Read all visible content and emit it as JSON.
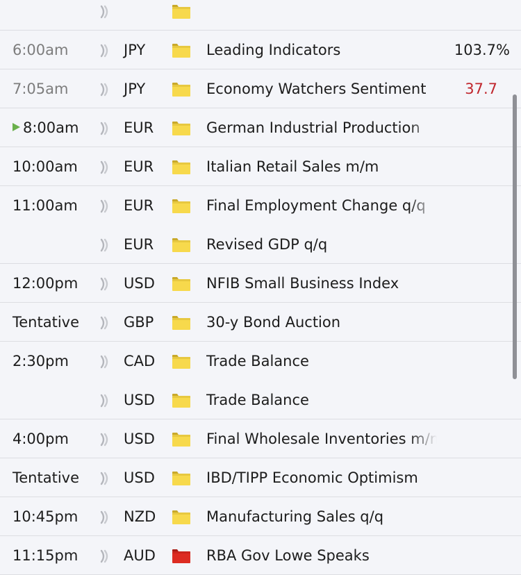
{
  "colors": {
    "background": "#f4f5f9",
    "separator": "#dcdde2",
    "impact_medium": "#f7d94c",
    "impact_high": "#dd2c22",
    "negative_value": "#c0262d",
    "now_marker": "#6ab04c"
  },
  "icons": {
    "sound": "speaker-waves-icon",
    "impact_medium": "yellow-folder-icon",
    "impact_high": "red-folder-icon",
    "now": "play-triangle-icon"
  },
  "events": [
    {
      "time": "",
      "currency": "",
      "impact": "medium",
      "title": "",
      "actual": "",
      "separator": true
    },
    {
      "time": "6:00am",
      "currency": "JPY",
      "impact": "medium",
      "title": "Leading Indicators",
      "actual": "103.7%",
      "past": true,
      "separator": true
    },
    {
      "time": "7:05am",
      "currency": "JPY",
      "impact": "medium",
      "title": "Economy Watchers Sentiment",
      "actual": "37.7",
      "actual_red": true,
      "past": true,
      "separator": true
    },
    {
      "time": "8:00am",
      "currency": "EUR",
      "impact": "medium",
      "title": "German Industrial Production",
      "actual": "",
      "now": true,
      "separator": true
    },
    {
      "time": "10:00am",
      "currency": "EUR",
      "impact": "medium",
      "title": "Italian Retail Sales m/m",
      "actual": "",
      "separator": true
    },
    {
      "time": "11:00am",
      "currency": "EUR",
      "impact": "medium",
      "title": "Final Employment Change q/q",
      "actual": "",
      "separator": false
    },
    {
      "time": "",
      "currency": "EUR",
      "impact": "medium",
      "title": "Revised GDP q/q",
      "actual": "",
      "separator": true
    },
    {
      "time": "12:00pm",
      "currency": "USD",
      "impact": "medium",
      "title": "NFIB Small Business Index",
      "actual": "",
      "separator": true
    },
    {
      "time": "Tentative",
      "currency": "GBP",
      "impact": "medium",
      "title": "30-y Bond Auction",
      "actual": "",
      "separator": true
    },
    {
      "time": "2:30pm",
      "currency": "CAD",
      "impact": "medium",
      "title": "Trade Balance",
      "actual": "",
      "separator": false
    },
    {
      "time": "",
      "currency": "USD",
      "impact": "medium",
      "title": "Trade Balance",
      "actual": "",
      "separator": true
    },
    {
      "time": "4:00pm",
      "currency": "USD",
      "impact": "medium",
      "title": "Final Wholesale Inventories m/m",
      "actual": "",
      "separator": true
    },
    {
      "time": "Tentative",
      "currency": "USD",
      "impact": "medium",
      "title": "IBD/TIPP Economic Optimism",
      "actual": "",
      "separator": true
    },
    {
      "time": "10:45pm",
      "currency": "NZD",
      "impact": "medium",
      "title": "Manufacturing Sales q/q",
      "actual": "",
      "separator": true
    },
    {
      "time": "11:15pm",
      "currency": "AUD",
      "impact": "high",
      "title": "RBA Gov Lowe Speaks",
      "actual": "",
      "separator": true
    }
  ]
}
